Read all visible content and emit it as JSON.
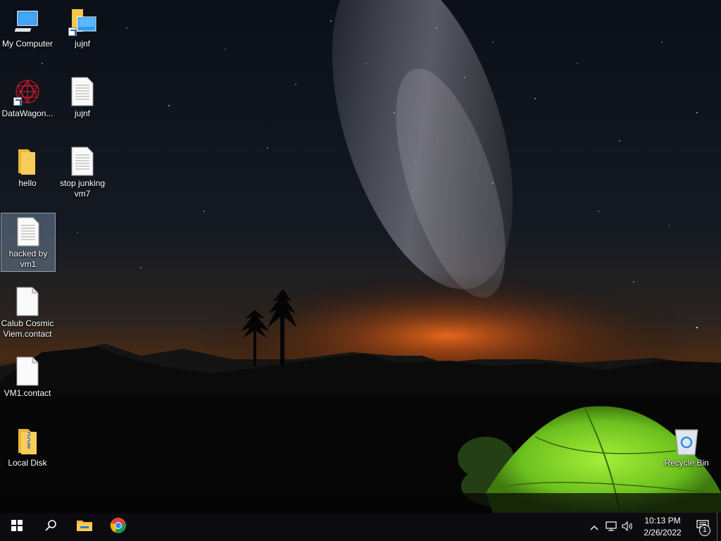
{
  "desktop": {
    "icons": [
      {
        "label": "My Computer",
        "icon": "computer-icon"
      },
      {
        "label": "jujnf",
        "icon": "folder-shortcut-icon"
      },
      {
        "label": "DataWagon...",
        "icon": "datawagon-icon"
      },
      {
        "label": "jujnf",
        "icon": "text-file-icon"
      },
      {
        "label": "hello",
        "icon": "folder-icon"
      },
      {
        "label": "stop junking vm7",
        "icon": "text-file-icon"
      },
      {
        "label": "hacked by vm1",
        "icon": "text-file-icon",
        "selected": true
      },
      {
        "label": "Calub Cosmic Viem.contact",
        "icon": "blank-file-icon"
      },
      {
        "label": "VM1.contact",
        "icon": "blank-file-icon"
      },
      {
        "label": "Local Disk",
        "icon": "zip-folder-icon"
      },
      {
        "label": "Recycle Bin",
        "icon": "recycle-bin-icon"
      }
    ]
  },
  "taskbar": {
    "start": "start-icon",
    "search": "search-icon",
    "pinned": [
      "file-explorer-icon",
      "chrome-icon"
    ],
    "tray": {
      "time": "10:13 PM",
      "date": "2/26/2022",
      "notification_count": "1"
    }
  },
  "colors": {
    "taskbar_bg": "#0c0c10",
    "tent_green": "#7fd32a",
    "horizon_orange": "#e4621a",
    "selection": "#a0bedc"
  }
}
